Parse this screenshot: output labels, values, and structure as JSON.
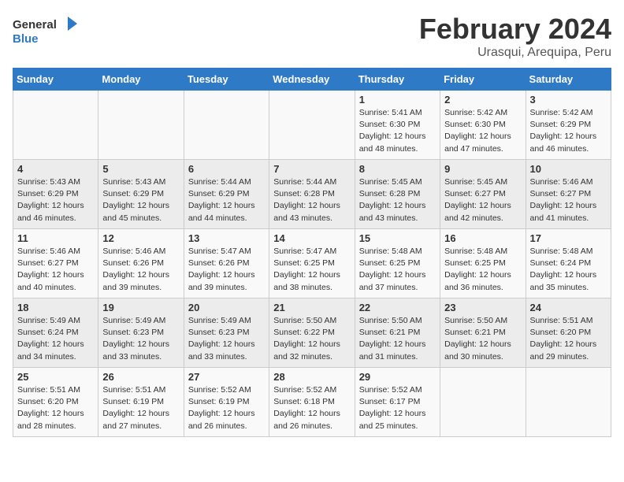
{
  "header": {
    "logo_general": "General",
    "logo_blue": "Blue",
    "title": "February 2024",
    "location": "Urasqui, Arequipa, Peru"
  },
  "weekdays": [
    "Sunday",
    "Monday",
    "Tuesday",
    "Wednesday",
    "Thursday",
    "Friday",
    "Saturday"
  ],
  "weeks": [
    [
      {
        "day": "",
        "info": ""
      },
      {
        "day": "",
        "info": ""
      },
      {
        "day": "",
        "info": ""
      },
      {
        "day": "",
        "info": ""
      },
      {
        "day": "1",
        "info": "Sunrise: 5:41 AM\nSunset: 6:30 PM\nDaylight: 12 hours\nand 48 minutes."
      },
      {
        "day": "2",
        "info": "Sunrise: 5:42 AM\nSunset: 6:30 PM\nDaylight: 12 hours\nand 47 minutes."
      },
      {
        "day": "3",
        "info": "Sunrise: 5:42 AM\nSunset: 6:29 PM\nDaylight: 12 hours\nand 46 minutes."
      }
    ],
    [
      {
        "day": "4",
        "info": "Sunrise: 5:43 AM\nSunset: 6:29 PM\nDaylight: 12 hours\nand 46 minutes."
      },
      {
        "day": "5",
        "info": "Sunrise: 5:43 AM\nSunset: 6:29 PM\nDaylight: 12 hours\nand 45 minutes."
      },
      {
        "day": "6",
        "info": "Sunrise: 5:44 AM\nSunset: 6:29 PM\nDaylight: 12 hours\nand 44 minutes."
      },
      {
        "day": "7",
        "info": "Sunrise: 5:44 AM\nSunset: 6:28 PM\nDaylight: 12 hours\nand 43 minutes."
      },
      {
        "day": "8",
        "info": "Sunrise: 5:45 AM\nSunset: 6:28 PM\nDaylight: 12 hours\nand 43 minutes."
      },
      {
        "day": "9",
        "info": "Sunrise: 5:45 AM\nSunset: 6:27 PM\nDaylight: 12 hours\nand 42 minutes."
      },
      {
        "day": "10",
        "info": "Sunrise: 5:46 AM\nSunset: 6:27 PM\nDaylight: 12 hours\nand 41 minutes."
      }
    ],
    [
      {
        "day": "11",
        "info": "Sunrise: 5:46 AM\nSunset: 6:27 PM\nDaylight: 12 hours\nand 40 minutes."
      },
      {
        "day": "12",
        "info": "Sunrise: 5:46 AM\nSunset: 6:26 PM\nDaylight: 12 hours\nand 39 minutes."
      },
      {
        "day": "13",
        "info": "Sunrise: 5:47 AM\nSunset: 6:26 PM\nDaylight: 12 hours\nand 39 minutes."
      },
      {
        "day": "14",
        "info": "Sunrise: 5:47 AM\nSunset: 6:25 PM\nDaylight: 12 hours\nand 38 minutes."
      },
      {
        "day": "15",
        "info": "Sunrise: 5:48 AM\nSunset: 6:25 PM\nDaylight: 12 hours\nand 37 minutes."
      },
      {
        "day": "16",
        "info": "Sunrise: 5:48 AM\nSunset: 6:25 PM\nDaylight: 12 hours\nand 36 minutes."
      },
      {
        "day": "17",
        "info": "Sunrise: 5:48 AM\nSunset: 6:24 PM\nDaylight: 12 hours\nand 35 minutes."
      }
    ],
    [
      {
        "day": "18",
        "info": "Sunrise: 5:49 AM\nSunset: 6:24 PM\nDaylight: 12 hours\nand 34 minutes."
      },
      {
        "day": "19",
        "info": "Sunrise: 5:49 AM\nSunset: 6:23 PM\nDaylight: 12 hours\nand 33 minutes."
      },
      {
        "day": "20",
        "info": "Sunrise: 5:49 AM\nSunset: 6:23 PM\nDaylight: 12 hours\nand 33 minutes."
      },
      {
        "day": "21",
        "info": "Sunrise: 5:50 AM\nSunset: 6:22 PM\nDaylight: 12 hours\nand 32 minutes."
      },
      {
        "day": "22",
        "info": "Sunrise: 5:50 AM\nSunset: 6:21 PM\nDaylight: 12 hours\nand 31 minutes."
      },
      {
        "day": "23",
        "info": "Sunrise: 5:50 AM\nSunset: 6:21 PM\nDaylight: 12 hours\nand 30 minutes."
      },
      {
        "day": "24",
        "info": "Sunrise: 5:51 AM\nSunset: 6:20 PM\nDaylight: 12 hours\nand 29 minutes."
      }
    ],
    [
      {
        "day": "25",
        "info": "Sunrise: 5:51 AM\nSunset: 6:20 PM\nDaylight: 12 hours\nand 28 minutes."
      },
      {
        "day": "26",
        "info": "Sunrise: 5:51 AM\nSunset: 6:19 PM\nDaylight: 12 hours\nand 27 minutes."
      },
      {
        "day": "27",
        "info": "Sunrise: 5:52 AM\nSunset: 6:19 PM\nDaylight: 12 hours\nand 26 minutes."
      },
      {
        "day": "28",
        "info": "Sunrise: 5:52 AM\nSunset: 6:18 PM\nDaylight: 12 hours\nand 26 minutes."
      },
      {
        "day": "29",
        "info": "Sunrise: 5:52 AM\nSunset: 6:17 PM\nDaylight: 12 hours\nand 25 minutes."
      },
      {
        "day": "",
        "info": ""
      },
      {
        "day": "",
        "info": ""
      }
    ]
  ]
}
